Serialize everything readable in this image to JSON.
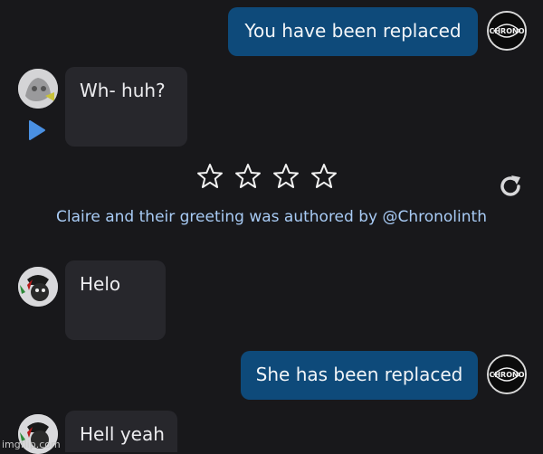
{
  "messages": [
    {
      "role": "user",
      "text": "You have been replaced"
    },
    {
      "role": "bot",
      "text": "Wh- huh?"
    },
    {
      "role": "bot",
      "text": "Helo"
    },
    {
      "role": "user",
      "text": "She has been replaced"
    },
    {
      "role": "bot",
      "text": "Hell yeah"
    }
  ],
  "rating": {
    "stars": 4,
    "selected": 0
  },
  "attribution": "Claire and their greeting was authored by @Chronolinth",
  "icons": {
    "play": "play-icon",
    "regenerate": "regenerate-icon",
    "star": "star-outline-icon"
  },
  "colors": {
    "background": "#18181b",
    "user_bubble": "#0e4a7a",
    "bot_bubble": "#27272c",
    "link": "#a8cbf5",
    "play_icon": "#4a90e2"
  },
  "user_avatar_text": "CHRONO",
  "watermark": "imgflip.com"
}
